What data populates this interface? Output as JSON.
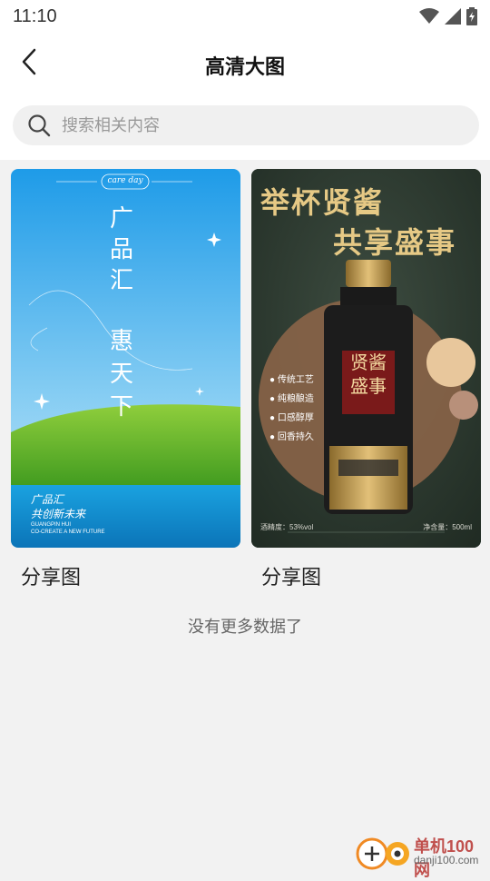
{
  "status_bar": {
    "time": "11:10",
    "icons": [
      "wifi-icon",
      "signal-icon",
      "battery-icon"
    ]
  },
  "header": {
    "back_icon": "chevron-left-icon",
    "title": "高清大图"
  },
  "search": {
    "icon": "search-icon",
    "placeholder": "搜索相关内容"
  },
  "cards": [
    {
      "label": "分享图",
      "poster": {
        "badge": "care day",
        "heading_lines": [
          "广",
          "品",
          "汇"
        ],
        "heading2_lines": [
          "惠",
          "天",
          "下"
        ],
        "slogan_line1": "广品汇",
        "slogan_line2": "共创新未来",
        "small_line1": "GUANGPIN HUI",
        "small_line2": "CO-CREATE A NEW FUTURE"
      }
    },
    {
      "label": "分享图",
      "poster": {
        "headline1": "举杯贤酱",
        "headline2": "共享盛事",
        "bottle_label_line1": "贤酱",
        "bottle_label_line2": "盛事",
        "bullets": [
          "传统工艺",
          "纯粮酿造",
          "口感醇厚",
          "回香持久"
        ],
        "abv": "酒精度：53%vol",
        "volume": "净含量：500ml"
      }
    }
  ],
  "footer_text": "没有更多数据了",
  "watermark": {
    "text1": "单机100网",
    "text2": "danji100.com"
  },
  "colors": {
    "title": "#111111",
    "page_bg": "#f2f2f2",
    "poster2_bg": "#2c3a30",
    "gold": "#d4a85a"
  }
}
